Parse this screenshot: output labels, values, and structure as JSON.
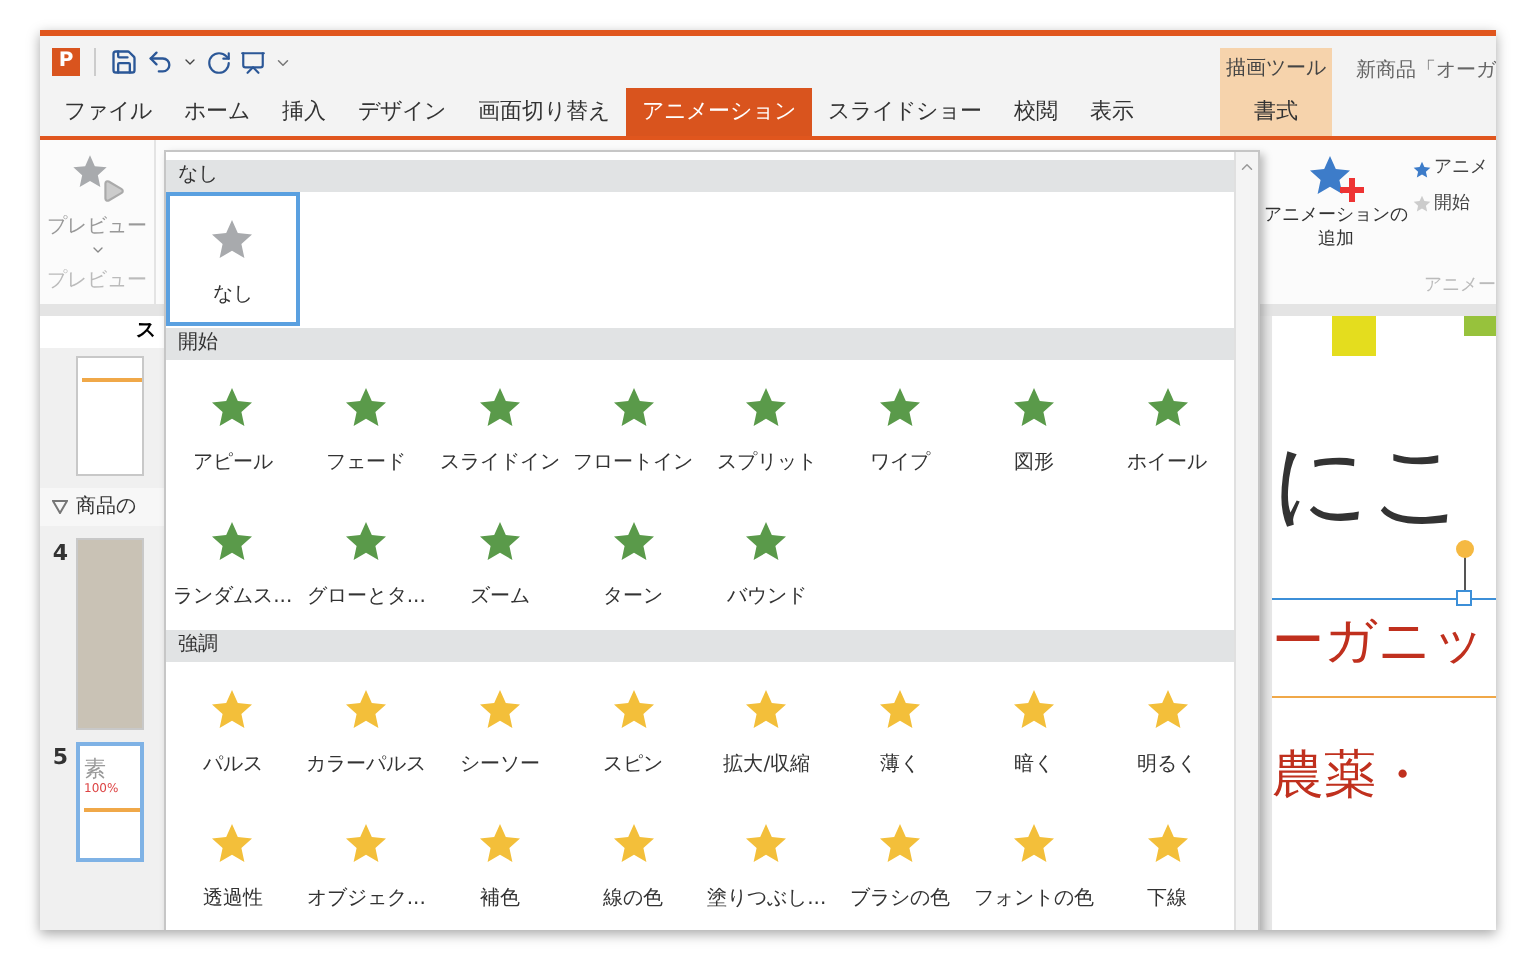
{
  "app": {
    "logo": "P",
    "title": "新商品「オーガ"
  },
  "contextual_group": "描画ツール",
  "tabs": [
    {
      "label": "ファイル",
      "selected": false,
      "contextual": false
    },
    {
      "label": "ホーム",
      "selected": false,
      "contextual": false
    },
    {
      "label": "挿入",
      "selected": false,
      "contextual": false
    },
    {
      "label": "デザイン",
      "selected": false,
      "contextual": false
    },
    {
      "label": "画面切り替え",
      "selected": false,
      "contextual": false
    },
    {
      "label": "アニメーション",
      "selected": true,
      "contextual": false
    },
    {
      "label": "スライドショー",
      "selected": false,
      "contextual": false
    },
    {
      "label": "校閲",
      "selected": false,
      "contextual": false
    },
    {
      "label": "表示",
      "selected": false,
      "contextual": false
    },
    {
      "label": "書式",
      "selected": false,
      "contextual": true
    }
  ],
  "ribbon": {
    "preview_button": "プレビュー",
    "preview_group": "プレビュー",
    "add_animation_lines": [
      "アニメーションの",
      "追加"
    ],
    "side_items": [
      "アニメ",
      "開始"
    ],
    "group_label": "アニメー"
  },
  "slides_pane": {
    "header": "ス",
    "section": "商品の",
    "slides": [
      {
        "kind": "text",
        "selected": false
      },
      {
        "kind": "photo",
        "number": "4",
        "selected": false
      },
      {
        "kind": "text",
        "number": "5",
        "selected": true,
        "title": "素",
        "subtitle": "100%"
      }
    ]
  },
  "slide": {
    "title": "にこ",
    "subtitle": "ーガニッ",
    "body": "農薬・"
  },
  "gallery": {
    "sections": [
      {
        "title": "なし",
        "kind": "none",
        "items": [
          {
            "label": "なし",
            "selected": true
          }
        ]
      },
      {
        "title": "開始",
        "kind": "entrance",
        "items": [
          {
            "label": "アピール",
            "selected": false
          },
          {
            "label": "フェード",
            "selected": false
          },
          {
            "label": "スライドイン",
            "selected": false
          },
          {
            "label": "フロートイン",
            "selected": false
          },
          {
            "label": "スプリット",
            "selected": false
          },
          {
            "label": "ワイプ",
            "selected": false
          },
          {
            "label": "図形",
            "selected": false
          },
          {
            "label": "ホイール",
            "selected": false
          },
          {
            "label": "ランダムス...",
            "selected": false
          },
          {
            "label": "グローとタ...",
            "selected": false
          },
          {
            "label": "ズーム",
            "selected": false
          },
          {
            "label": "ターン",
            "selected": false
          },
          {
            "label": "バウンド",
            "selected": false
          }
        ]
      },
      {
        "title": "強調",
        "kind": "emphasis",
        "items": [
          {
            "label": "パルス",
            "selected": false
          },
          {
            "label": "カラーパルス",
            "selected": false
          },
          {
            "label": "シーソー",
            "selected": false
          },
          {
            "label": "スピン",
            "selected": false
          },
          {
            "label": "拡大/収縮",
            "selected": false
          },
          {
            "label": "薄く",
            "selected": false
          },
          {
            "label": "暗く",
            "selected": false
          },
          {
            "label": "明るく",
            "selected": false
          },
          {
            "label": "透過性",
            "selected": false
          },
          {
            "label": "オブジェク...",
            "selected": false
          },
          {
            "label": "補色",
            "selected": false
          },
          {
            "label": "線の色",
            "selected": false
          },
          {
            "label": "塗りつぶし...",
            "selected": false
          },
          {
            "label": "ブラシの色",
            "selected": false
          },
          {
            "label": "フォントの色",
            "selected": false
          },
          {
            "label": "下線",
            "selected": false
          }
        ]
      }
    ]
  }
}
